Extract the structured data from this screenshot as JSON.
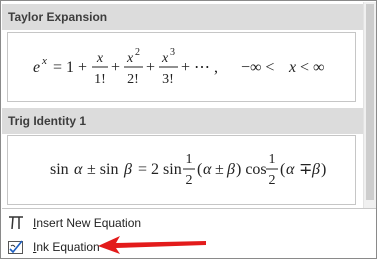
{
  "sections": [
    {
      "title": "Taylor Expansion",
      "equation_name": "e^x = 1 + x/1! + x^2/2! + x^3/3! + ⋯ , −∞ < x < ∞"
    },
    {
      "title": "Trig Identity 1",
      "equation_name": "sin α ± sin β = 2 sin ½(α ± β) cos ½(α ∓ β)"
    }
  ],
  "menu": {
    "insert_new_equation": {
      "accel": "I",
      "rest": "nsert New Equation",
      "icon": "pi-icon"
    },
    "ink_equation": {
      "accel": "I",
      "rest": "nk Equation",
      "icon": "ink-equation-icon"
    }
  },
  "annotation": {
    "color": "#e31b1b",
    "points_to": "ink_equation"
  }
}
